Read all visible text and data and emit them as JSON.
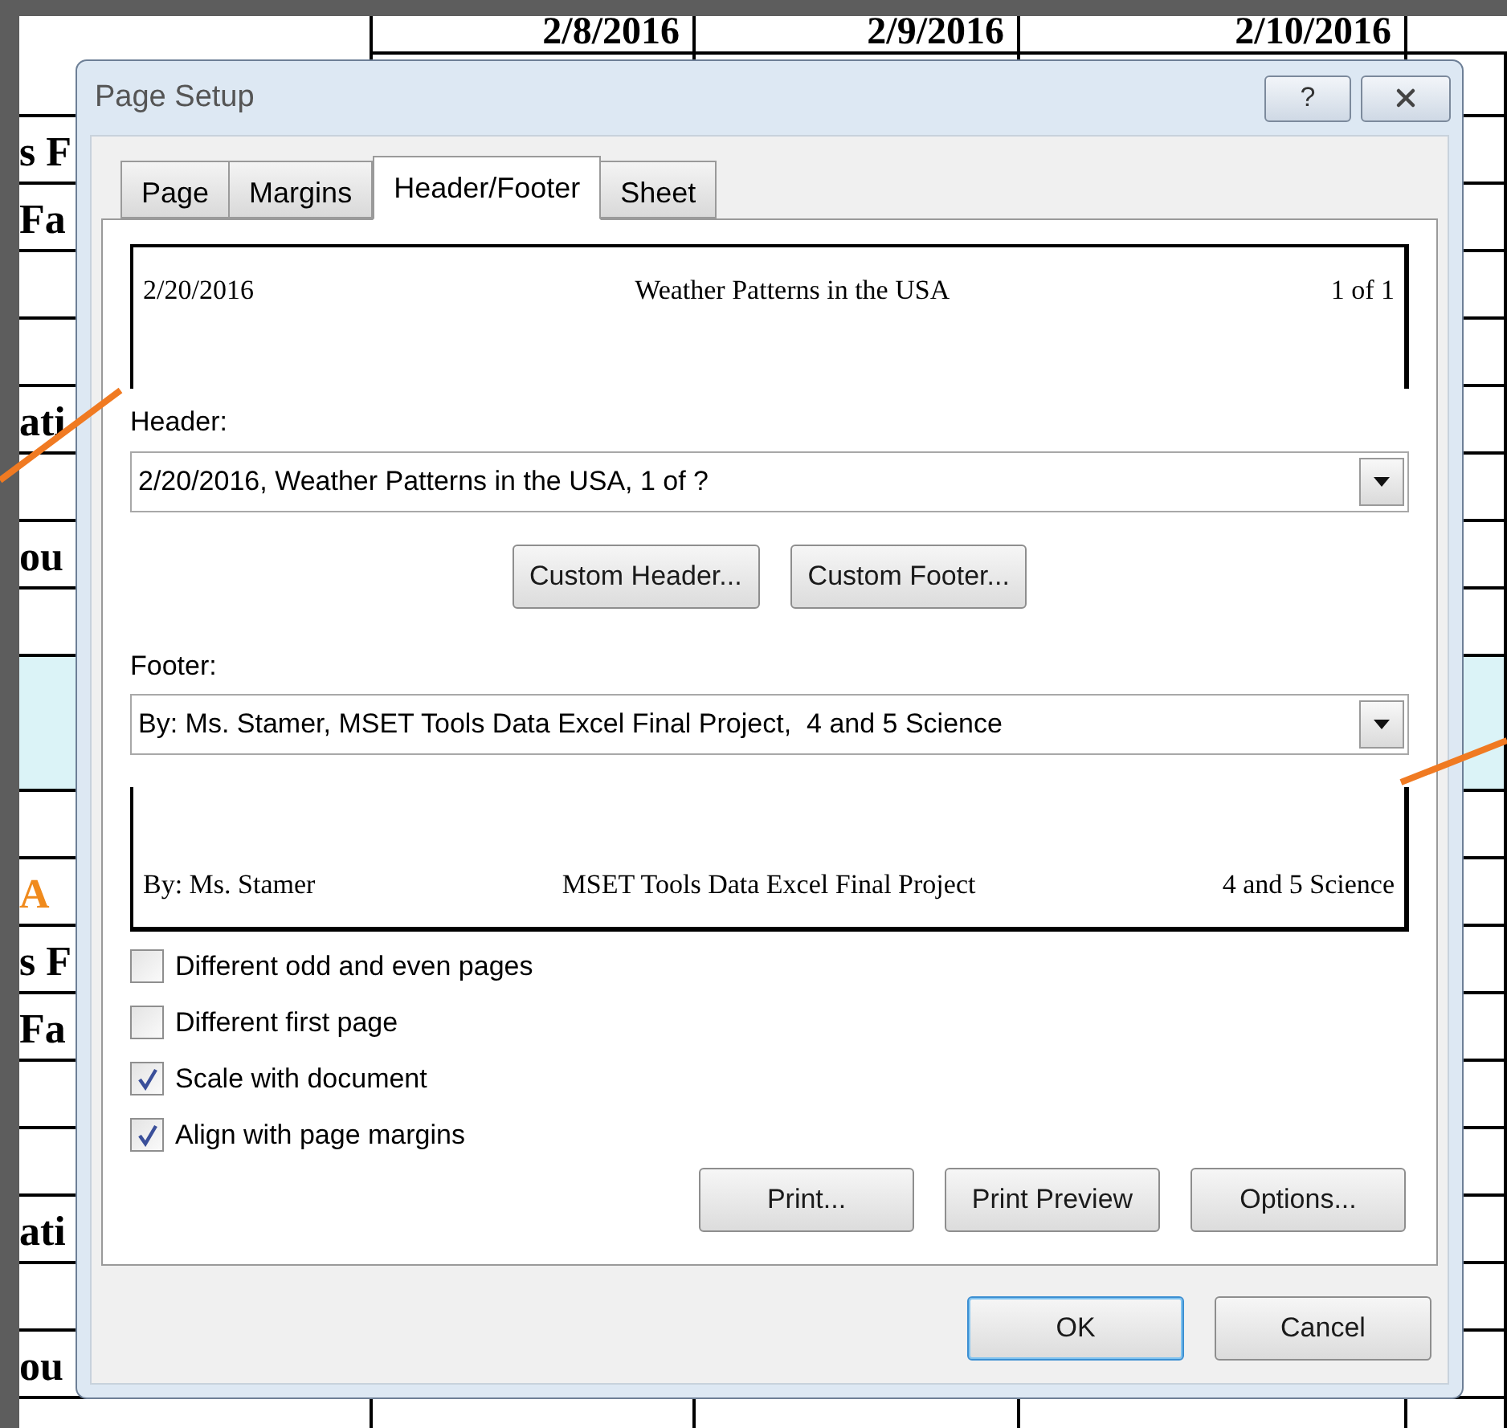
{
  "sheet": {
    "date_headers": [
      "2/8/2016",
      "2/9/2016",
      "2/10/2016"
    ],
    "rows": [
      {
        "label": "",
        "tint": false
      },
      {
        "label": "s F",
        "tint": false
      },
      {
        "label": "Fa",
        "tint": false
      },
      {
        "label": "",
        "tint": false
      },
      {
        "label": "",
        "tint": false
      },
      {
        "label": "ati",
        "tint": false
      },
      {
        "label": "",
        "tint": false
      },
      {
        "label": "ou",
        "tint": false
      },
      {
        "label": "",
        "tint": false
      },
      {
        "label": "",
        "tint": true
      },
      {
        "label": "",
        "tint": false
      },
      {
        "label": "A",
        "tint": false,
        "color": "#f08a1c"
      },
      {
        "label": "s F",
        "tint": false
      },
      {
        "label": "Fa",
        "tint": false
      },
      {
        "label": "",
        "tint": false
      },
      {
        "label": "",
        "tint": false
      },
      {
        "label": "ati",
        "tint": false
      },
      {
        "label": "",
        "tint": false
      },
      {
        "label": "ou",
        "tint": false
      },
      {
        "label": "",
        "tint": false
      }
    ]
  },
  "dialog": {
    "title": "Page Setup",
    "help_button": "?",
    "tabs": [
      {
        "label": "Page",
        "selected": false
      },
      {
        "label": "Margins",
        "selected": false
      },
      {
        "label": "Header/Footer",
        "selected": true
      },
      {
        "label": "Sheet",
        "selected": false
      }
    ],
    "header_preview": {
      "left": "2/20/2016",
      "center": "Weather Patterns in the USA",
      "right": "1 of 1"
    },
    "header": {
      "label": "Header:",
      "value": "2/20/2016, Weather Patterns in the USA, 1 of ?"
    },
    "custom_buttons": [
      "Custom Header...",
      "Custom Footer..."
    ],
    "footer": {
      "label": "Footer:",
      "value": "By: Ms. Stamer, MSET Tools Data Excel Final Project,  4 and 5 Science"
    },
    "footer_preview": {
      "left": "By: Ms. Stamer",
      "center": "MSET Tools Data Excel Final Project",
      "right": "4 and 5 Science"
    },
    "options": [
      {
        "label": "Different odd and even pages",
        "checked": false
      },
      {
        "label": "Different first page",
        "checked": false
      },
      {
        "label": "Scale with document",
        "checked": true
      },
      {
        "label": "Align with page margins",
        "checked": true
      }
    ],
    "action_buttons": [
      "Print...",
      "Print Preview",
      "Options..."
    ],
    "footer_buttons": [
      {
        "label": "OK",
        "default": true
      },
      {
        "label": "Cancel",
        "default": false
      }
    ]
  }
}
